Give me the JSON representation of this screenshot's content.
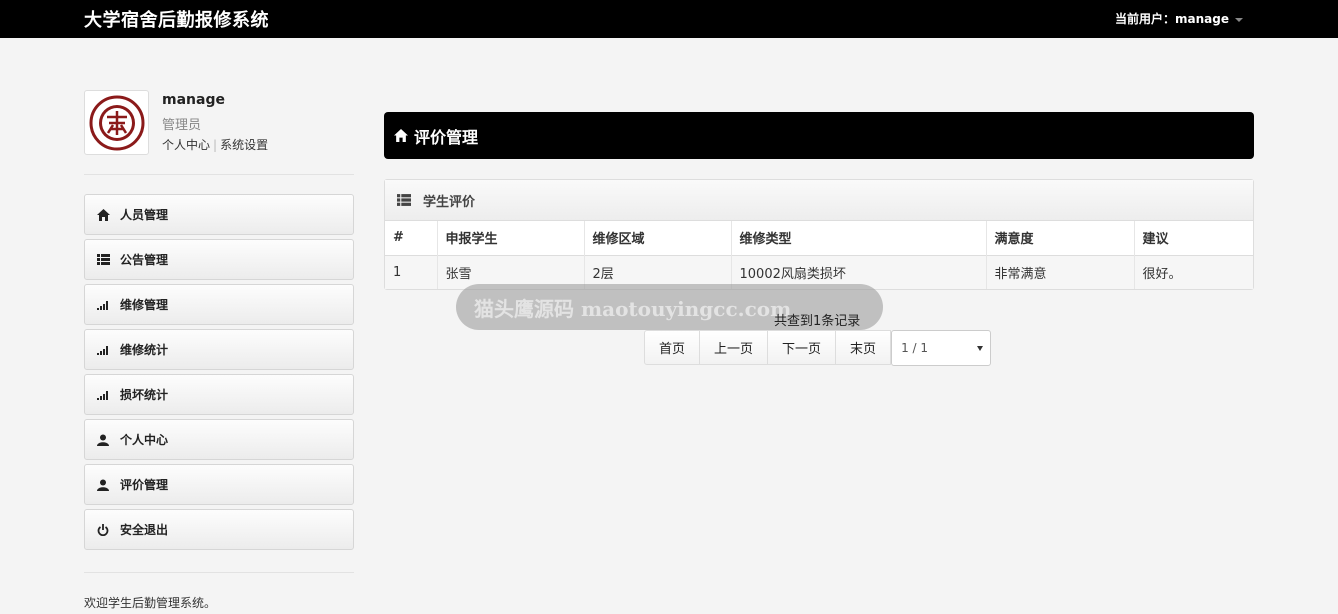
{
  "header": {
    "app_title": "大学宿舍后勤报修系统",
    "current_user_label": "当前用户：manage"
  },
  "profile": {
    "name": "manage",
    "role": "管理员",
    "link_personal": "个人中心",
    "link_settings": "系统设置",
    "separator": "|"
  },
  "sidebar": {
    "items": [
      {
        "label": "人员管理",
        "icon": "home-icon"
      },
      {
        "label": "公告管理",
        "icon": "list-icon"
      },
      {
        "label": "维修管理",
        "icon": "signal-icon"
      },
      {
        "label": "维修统计",
        "icon": "signal-icon"
      },
      {
        "label": "损坏统计",
        "icon": "signal-icon"
      },
      {
        "label": "个人中心",
        "icon": "user-icon"
      },
      {
        "label": "评价管理",
        "icon": "user-icon"
      },
      {
        "label": "安全退出",
        "icon": "power-icon"
      }
    ]
  },
  "footer": {
    "welcome": "欢迎学生后勤管理系统。"
  },
  "main": {
    "page_title": "评价管理",
    "panel_title": "学生评价",
    "table": {
      "columns": [
        "#",
        "申报学生",
        "维修区域",
        "维修类型",
        "满意度",
        "建议"
      ],
      "rows": [
        [
          "1",
          "张雪",
          "2层",
          "10002风扇类损坏",
          "非常满意",
          "很好。"
        ]
      ]
    },
    "watermark": "猫头鹰源码 maotouyingcc.com",
    "record_count": "共查到1条记录",
    "pager": {
      "first": "首页",
      "prev": "上一页",
      "next": "下一页",
      "last": "末页",
      "page_select": "1 / 1"
    }
  },
  "colors": {
    "topbar": "#000000",
    "page_header": "#000000",
    "background": "#f4f4f4",
    "logo_red": "#8b1a1a"
  }
}
